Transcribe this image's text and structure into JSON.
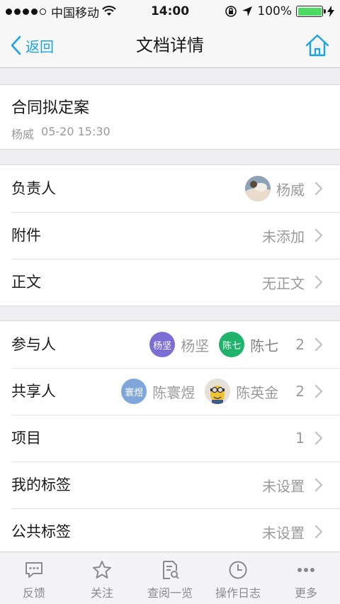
{
  "status_bar": {
    "carrier": "中国移动",
    "time": "14:00",
    "battery": "100%"
  },
  "nav": {
    "back_label": "返回",
    "title": "文档详情"
  },
  "document": {
    "title": "合同拟定案",
    "author": "杨威",
    "datetime": "05-20 15:30"
  },
  "details": {
    "owner": {
      "label": "负责人",
      "name": "杨威"
    },
    "attachment": {
      "label": "附件",
      "value": "未添加"
    },
    "body": {
      "label": "正文",
      "value": "无正文"
    }
  },
  "people": {
    "participants": {
      "label": "参与人",
      "members": [
        {
          "avatar_text": "杨坚",
          "name": "杨坚",
          "color": "#7b6fd6"
        },
        {
          "avatar_text": "陈七",
          "name": "陈七",
          "color": "#1fb36b"
        }
      ],
      "count": "2"
    },
    "shared": {
      "label": "共享人",
      "members": [
        {
          "avatar_text": "寰煜",
          "name": "陈寰煜",
          "color": "#7fa6dc"
        },
        {
          "name": "陈英金"
        }
      ],
      "count": "2"
    },
    "project": {
      "label": "项目",
      "count": "1"
    },
    "my_tags": {
      "label": "我的标签",
      "value": "未设置"
    },
    "public_tags": {
      "label": "公共标签",
      "value": "未设置"
    }
  },
  "tabs": [
    {
      "label": "反馈",
      "icon": "chat-bubble-icon"
    },
    {
      "label": "关注",
      "icon": "star-icon"
    },
    {
      "label": "查阅一览",
      "icon": "document-search-icon"
    },
    {
      "label": "操作日志",
      "icon": "clock-icon"
    },
    {
      "label": "更多",
      "icon": "more-dots-icon"
    }
  ],
  "colors": {
    "accent": "#1aa3e6",
    "battery": "#4cd964"
  }
}
